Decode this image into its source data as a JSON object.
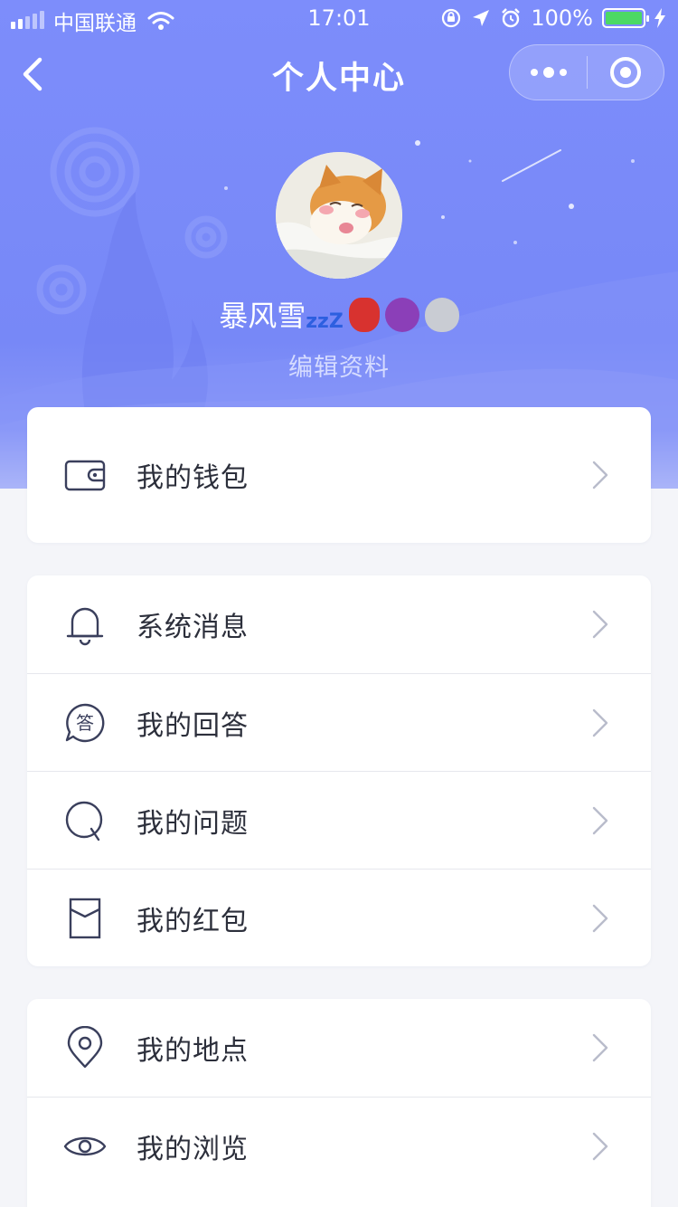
{
  "status_bar": {
    "carrier": "中国联通",
    "time": "17:01",
    "battery_text": "100%"
  },
  "nav": {
    "title": "个人中心"
  },
  "profile": {
    "name": "暴风雪",
    "name_suffix": "zzZ",
    "edit_label": "编辑资料"
  },
  "menu_groups": [
    {
      "items": [
        {
          "label": "我的钱包",
          "icon": "wallet-icon"
        }
      ]
    },
    {
      "items": [
        {
          "label": "系统消息",
          "icon": "bell-icon"
        },
        {
          "label": "我的回答",
          "icon": "answer-bubble-icon"
        },
        {
          "label": "我的问题",
          "icon": "question-icon"
        },
        {
          "label": "我的红包",
          "icon": "red-envelope-icon"
        }
      ]
    },
    {
      "items": [
        {
          "label": "我的地点",
          "icon": "location-pin-icon"
        },
        {
          "label": "我的浏览",
          "icon": "eye-icon"
        }
      ]
    }
  ],
  "colors": {
    "header_bg": "#7d8dfb",
    "page_bg": "#f4f5f9",
    "icon_stroke": "#3a3f5c",
    "chevron": "#b9bccb"
  }
}
